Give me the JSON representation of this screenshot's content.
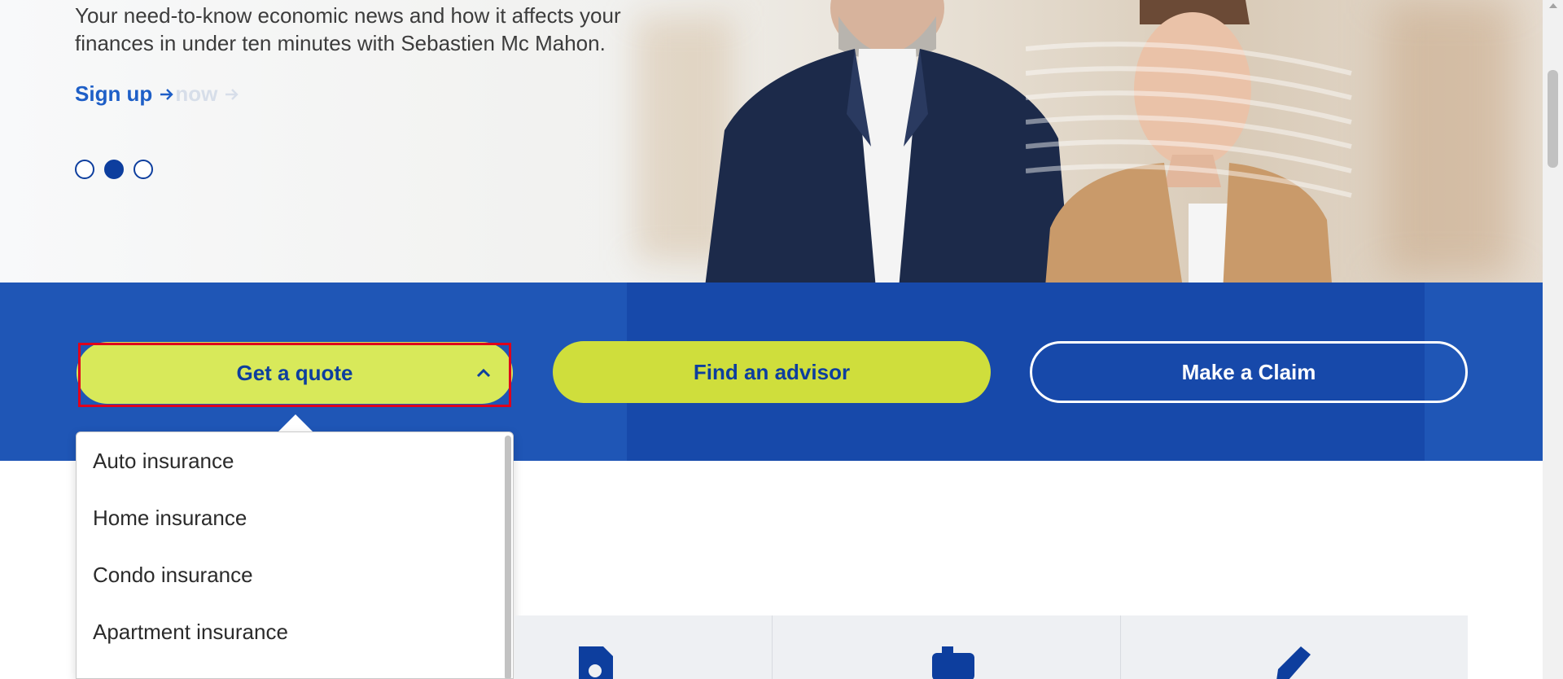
{
  "hero": {
    "description": "Your need-to-know economic news and how it affects your finances in under ten minutes with Sebastien Mc Mahon.",
    "signup_label": "Sign up",
    "ghost_label": "now",
    "slides": 3,
    "active_slide": 2
  },
  "actions": {
    "quote_label": "Get a quote",
    "advisor_label": "Find an advisor",
    "claim_label": "Make a Claim"
  },
  "quote_menu": {
    "items": [
      "Auto insurance",
      "Home insurance",
      "Condo insurance",
      "Apartment insurance"
    ]
  },
  "colors": {
    "brand_blue": "#1f56b6",
    "dark_blue": "#0d3e9e",
    "lime": "#d8e95a",
    "focus_red": "#e0001b"
  }
}
